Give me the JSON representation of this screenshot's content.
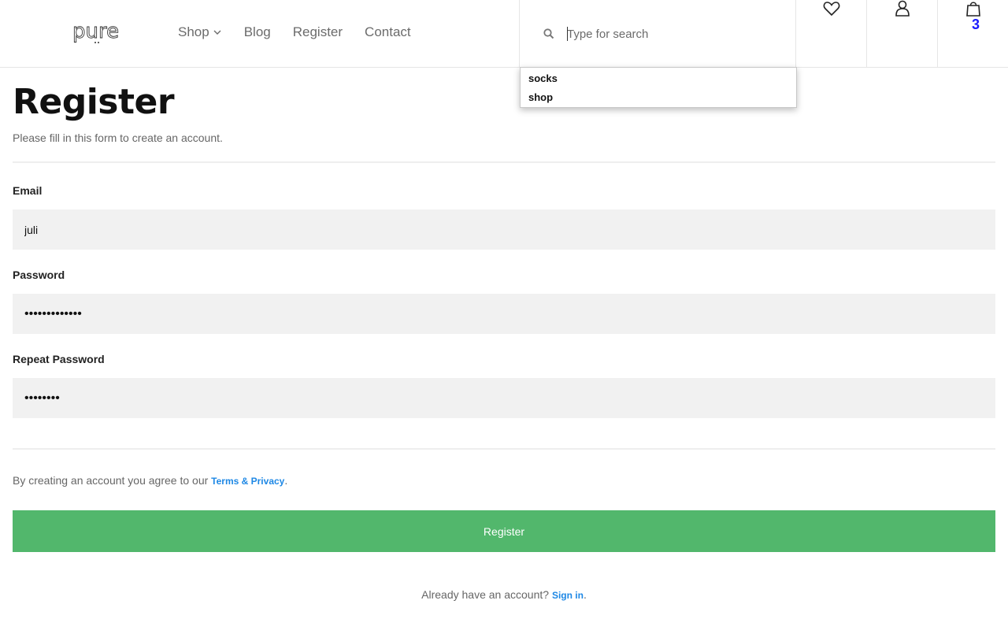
{
  "header": {
    "logo_text": "pure",
    "nav": [
      {
        "label": "Shop"
      },
      {
        "label": "Blog"
      },
      {
        "label": "Register"
      },
      {
        "label": "Contact"
      }
    ],
    "search": {
      "placeholder": "Type for search",
      "value": ""
    },
    "cart_count": "3"
  },
  "suggestions": [
    "socks",
    "shop"
  ],
  "form": {
    "title": "Register",
    "subtitle": "Please fill in this form to create an account.",
    "email_label": "Email",
    "email_value": "juli",
    "password_label": "Password",
    "password_value": "•••••••••••••",
    "repeat_label": "Repeat Password",
    "repeat_value": "••••••••",
    "terms_prefix": "By creating an account you agree to our ",
    "terms_link": "Terms & Privacy",
    "terms_suffix": ".",
    "submit_label": "Register",
    "signin_prefix": "Already have an account? ",
    "signin_link": "Sign in",
    "signin_suffix": "."
  },
  "colors": {
    "accent_green": "#52b76c",
    "link_blue": "#1e88e5",
    "cart_count": "#1a1aff",
    "field_bg": "#f1f1f1"
  },
  "icons": [
    "search-icon",
    "heart-icon",
    "user-icon",
    "shopping-bag-icon",
    "chevron-down-icon"
  ]
}
